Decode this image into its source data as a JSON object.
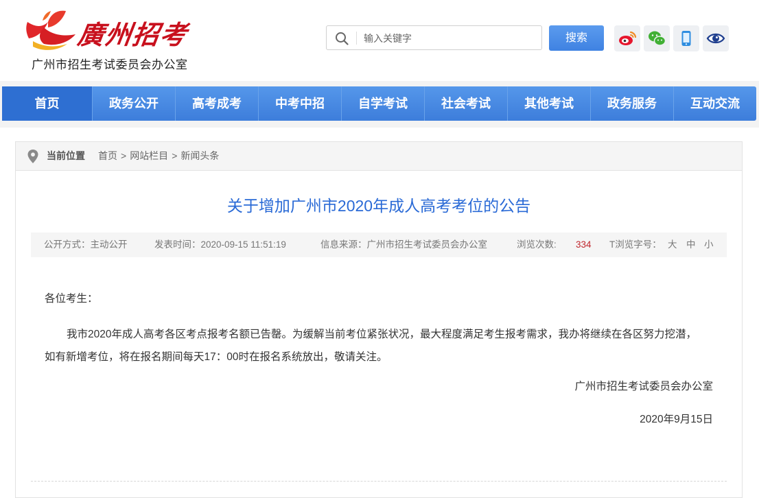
{
  "header": {
    "logo_text": "廣州招考",
    "org_name": "广州市招生考试委员会办公室",
    "search": {
      "placeholder": "输入关键字",
      "button_label": "搜索"
    },
    "social_icons": [
      "weibo-icon",
      "wechat-icon",
      "mobile-icon",
      "eye-icon"
    ]
  },
  "nav": {
    "items": [
      {
        "label": "首页",
        "active": true
      },
      {
        "label": "政务公开"
      },
      {
        "label": "高考成考"
      },
      {
        "label": "中考中招"
      },
      {
        "label": "自学考试"
      },
      {
        "label": "社会考试"
      },
      {
        "label": "其他考试"
      },
      {
        "label": "政务服务"
      },
      {
        "label": "互动交流"
      }
    ]
  },
  "breadcrumb": {
    "label": "当前位置",
    "items": [
      "首页",
      "网站栏目",
      "新闻头条"
    ],
    "separator": ">"
  },
  "article": {
    "title": "关于增加广州市2020年成人高考考位的公告",
    "meta": {
      "publish_mode": "公开方式：主动公开",
      "publish_time": "发表时间：2020-09-15 11:51:19",
      "source": "信息来源：广州市招生考试委员会办公室",
      "views_label": "浏览次数:",
      "views_value": "334",
      "font_size_label": "T浏览字号：",
      "font_sizes": [
        "大",
        "中",
        "小"
      ]
    },
    "greeting": "各位考生：",
    "paragraph": "我市2020年成人高考各区考点报考名额已告罄。为缓解当前考位紧张状况，最大程度满足考生报考需求，我办将继续在各区努力挖潜，如有新增考位，将在报名期间每天17：00时在报名系统放出，敬请关注。",
    "signature": "广州市招生考试委员会办公室",
    "date": "2020年9月15日"
  },
  "colors": {
    "nav_blue": "#3d7ddb",
    "title_blue": "#2a6ad6",
    "brand_red": "#c8101d",
    "views_red": "#c0262d"
  }
}
